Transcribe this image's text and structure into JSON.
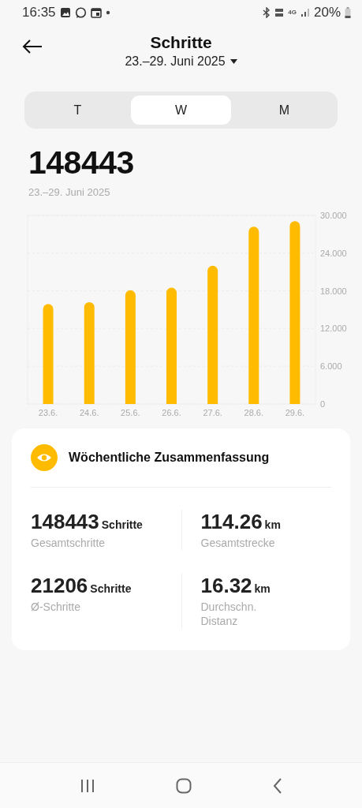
{
  "status_bar": {
    "time": "16:35",
    "network": "4G",
    "battery": "20%"
  },
  "header": {
    "title": "Schritte",
    "date_range": "23.–29. Juni 2025"
  },
  "tabs": [
    {
      "label": "T",
      "selected": false
    },
    {
      "label": "W",
      "selected": true
    },
    {
      "label": "M",
      "selected": false
    }
  ],
  "total": {
    "value": "148443",
    "date_range": "23.–29. Juni 2025"
  },
  "chart_data": {
    "type": "bar",
    "categories": [
      "23.6.",
      "24.6.",
      "25.6.",
      "26.6.",
      "27.6.",
      "28.6.",
      "29.6."
    ],
    "series": [
      {
        "color": "#ffbb00",
        "values": [
          15.9,
          16.2,
          18.1,
          18.5,
          22.0,
          28.2,
          29.1
        ]
      }
    ],
    "ylim": [
      0,
      30
    ],
    "grid": true,
    "yticks": [
      {
        "value": 0,
        "label": "0"
      },
      {
        "value": 6,
        "label": "6.000"
      },
      {
        "value": 12,
        "label": "12.000"
      },
      {
        "value": 18,
        "label": "18.000"
      },
      {
        "value": 24,
        "label": "24.000"
      },
      {
        "value": 30,
        "label": "30.000"
      }
    ]
  },
  "summary": {
    "title": "Wöchentliche Zusammenfassung",
    "stats": [
      {
        "value": "148443",
        "unit": "Schritte",
        "label": "Gesamtschritte"
      },
      {
        "value": "114.26",
        "unit": "km",
        "label": "Gesamtstrecke"
      },
      {
        "value": "21206",
        "unit": "Schritte",
        "label": "Ø-Schritte"
      },
      {
        "value": "16.32",
        "unit": "km",
        "label": "Durchschn. Distanz"
      }
    ]
  }
}
